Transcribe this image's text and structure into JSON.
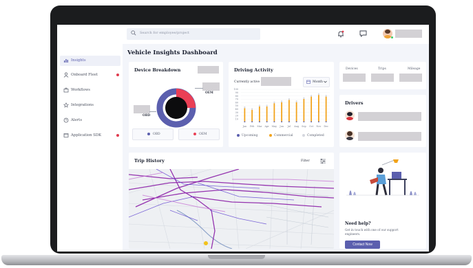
{
  "topbar": {
    "search_placeholder": "Search for employee/project"
  },
  "page": {
    "title": "Vehicle Insights Dashboard"
  },
  "sidebar": {
    "items": [
      {
        "label": "Insights",
        "icon": "bar-chart-icon",
        "active": true,
        "alert": false
      },
      {
        "label": "Onboard Fleet",
        "icon": "person-icon",
        "active": false,
        "alert": true
      },
      {
        "label": "Workflows",
        "icon": "briefcase-icon",
        "active": false,
        "alert": false
      },
      {
        "label": "Integrations",
        "icon": "star-icon",
        "active": false,
        "alert": false
      },
      {
        "label": "Alerts",
        "icon": "clock-icon",
        "active": false,
        "alert": false
      },
      {
        "label": "Application SDK",
        "icon": "window-icon",
        "active": false,
        "alert": true
      }
    ]
  },
  "device_breakdown": {
    "title": "Device Breakdown",
    "segments": [
      {
        "name": "OBD",
        "share": 0.7,
        "color": "#5b5fae"
      },
      {
        "name": "OEM",
        "share": 0.3,
        "color": "#ea3f55"
      }
    ],
    "label_oem": "OEM",
    "label_obd": "OBD",
    "legend_obd": "OBD",
    "legend_oem": "OEM"
  },
  "driving_activity": {
    "title": "Driving Activity",
    "currently_active_label": "Currently active",
    "period_select": "Month",
    "y_ticks": [
      "100",
      "90",
      "80",
      "70",
      "60",
      "50",
      "40",
      "30",
      "20",
      "10"
    ],
    "legend": {
      "upcoming": "Upcoming",
      "commercial": "Commercial",
      "completed": "Completed"
    },
    "colors": {
      "upcoming": "#5b5fae",
      "commercial": "#f2a31b",
      "completed": "#d5d7de"
    }
  },
  "chart_data": {
    "type": "bar",
    "categories": [
      "Jan",
      "Feb",
      "Mar",
      "Apr",
      "May",
      "Jun",
      "Jul",
      "Aug",
      "Sep",
      "Oct",
      "Nov",
      "Dec"
    ],
    "series": [
      {
        "name": "Upcoming",
        "values": [
          3,
          3,
          3,
          3,
          3,
          3,
          3,
          3,
          3,
          3,
          3,
          3
        ]
      },
      {
        "name": "Commercial",
        "values": [
          40,
          35,
          45,
          45,
          55,
          58,
          65,
          58,
          68,
          75,
          80,
          75
        ]
      },
      {
        "name": "Completed",
        "values": [
          5,
          5,
          5,
          5,
          5,
          5,
          5,
          5,
          5,
          5,
          5,
          5
        ]
      }
    ],
    "ylim": [
      0,
      100
    ],
    "grid": true
  },
  "stats": {
    "labels": [
      "Devices",
      "Trips",
      "Mileage"
    ]
  },
  "drivers": {
    "title": "Drivers"
  },
  "trip_history": {
    "title": "Trip History",
    "filter_label": "Filter"
  },
  "help": {
    "title": "Need help?",
    "text_line1": "Get in touch with one of our support",
    "text_line2": "engineers.",
    "button_label": "Contact Now",
    "accent": "#5b5fae"
  }
}
